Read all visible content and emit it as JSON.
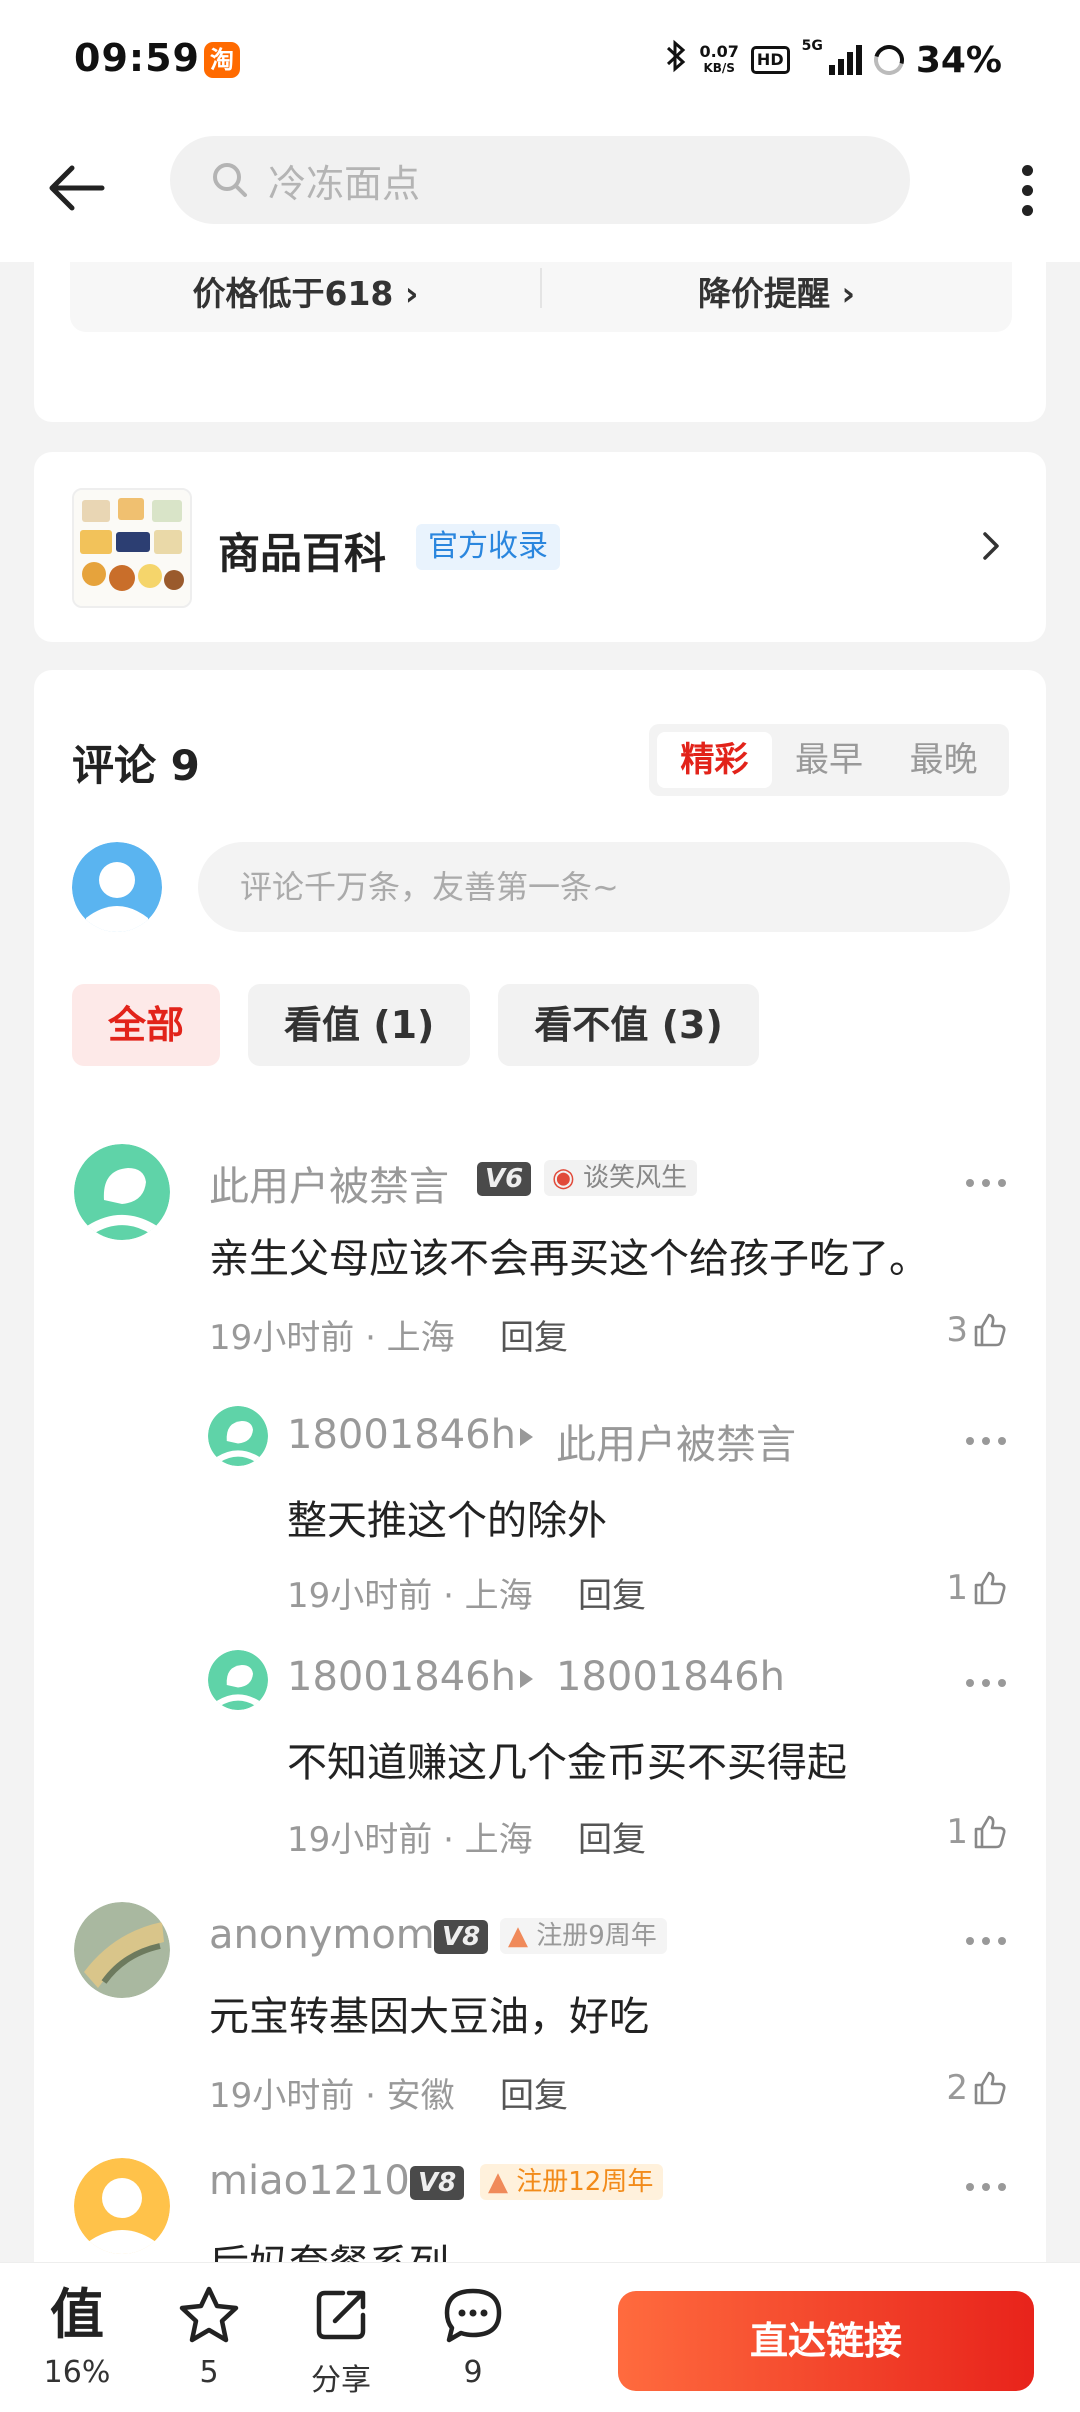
{
  "status_bar": {
    "time": "09:59",
    "app_badge": "淘",
    "net_speed_value": "0.07",
    "net_speed_unit": "KB/S",
    "hd_label": "HD",
    "network": "5G",
    "battery": "34%"
  },
  "top_nav": {
    "search_placeholder": "冷冻面点"
  },
  "price_row": {
    "left": "价格低于618 ›",
    "right": "降价提醒 ›"
  },
  "baike": {
    "title": "商品百科",
    "badge": "官方收录",
    "arrow": "›"
  },
  "comments": {
    "title": "评论 9",
    "sort_tabs": [
      "精彩",
      "最早",
      "最晚"
    ],
    "active_sort": "精彩",
    "input_placeholder": "评论千万条，友善第一条~",
    "filters": [
      "全部",
      "看值 (1)",
      "看不值 (3)"
    ],
    "active_filter": "全部",
    "items": [
      {
        "name": "此用户被禁言",
        "level": "V6",
        "tag": "谈笑风生",
        "text": "亲生父母应该不会再买这个给孩子吃了。",
        "time_loc": "19小时前 · 上海",
        "reply": "回复",
        "likes": "3",
        "avatar_color": "#5fd3a8"
      },
      {
        "name": "18001846h",
        "reply_to": "此用户被禁言",
        "text": "整天推这个的除外",
        "time_loc": "19小时前 · 上海",
        "reply": "回复",
        "likes": "1",
        "avatar_color": "#5fd3a8"
      },
      {
        "name": "18001846h",
        "reply_to": "18001846h",
        "text": "不知道赚这几个金币买不买得起",
        "time_loc": "19小时前 · 上海",
        "reply": "回复",
        "likes": "1",
        "avatar_color": "#5fd3a8"
      },
      {
        "name": "anonymom",
        "level": "V8",
        "tag": "注册9周年",
        "text": "元宝转基因大豆油，好吃",
        "time_loc": "19小时前 · 安徽",
        "reply": "回复",
        "likes": "2"
      },
      {
        "name": "miao1210",
        "level": "V8",
        "tag": "注册12周年",
        "text": "后妈套餐系列",
        "avatar_color": "#ffc24a"
      }
    ]
  },
  "bottom_bar": {
    "zhi_icon_text": "值",
    "zhi_label": "16%",
    "fav_label": "5",
    "share_label": "分享",
    "comment_label": "9",
    "cta": "直达链接"
  },
  "colors": {
    "accent": "#e2231a",
    "link_blue": "#2a86de",
    "avatar_green": "#5fd3a8",
    "avatar_blue": "#5ab4f0",
    "avatar_yellow": "#ffc24a"
  }
}
